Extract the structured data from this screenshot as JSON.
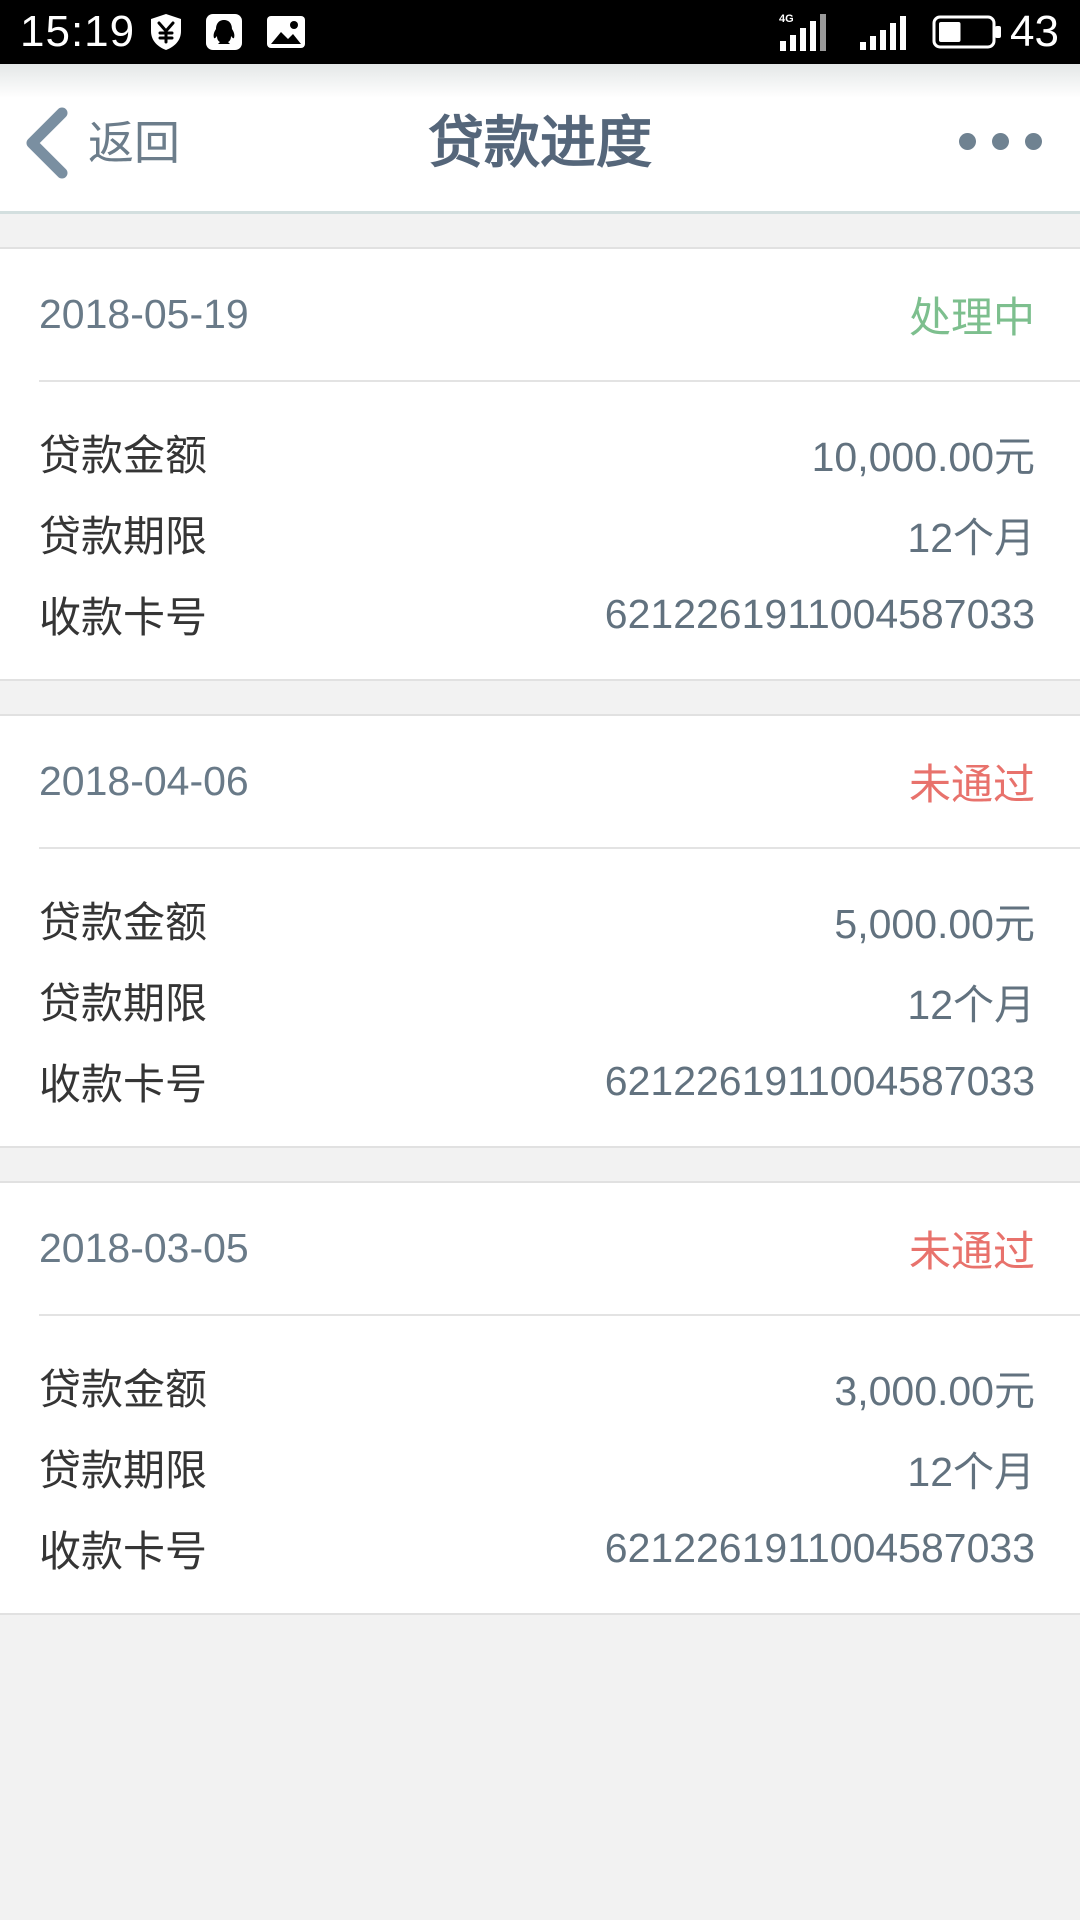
{
  "status_bar": {
    "time": "15:19",
    "network_type": "4G",
    "battery_percent": "43",
    "notification_icons": [
      "shield-yen-icon",
      "qq-icon",
      "image-icon"
    ],
    "system_icons": [
      "signal-4g-icon",
      "signal-icon",
      "battery-icon"
    ]
  },
  "nav": {
    "back_icon": "chevron-left-icon",
    "back_label": "返回",
    "title": "贷款进度",
    "more_icon": "more-dots-icon"
  },
  "loans": [
    {
      "date": "2018-05-19",
      "status": "处理中",
      "status_color": "#7dbf8e",
      "rows": [
        {
          "label": "贷款金额",
          "value": "10,000.00元"
        },
        {
          "label": "贷款期限",
          "value": "12个月"
        },
        {
          "label": "收款卡号",
          "value": "6212261911004587033"
        }
      ]
    },
    {
      "date": "2018-04-06",
      "status": "未通过",
      "status_color": "#e8726c",
      "rows": [
        {
          "label": "贷款金额",
          "value": "5,000.00元"
        },
        {
          "label": "贷款期限",
          "value": "12个月"
        },
        {
          "label": "收款卡号",
          "value": "6212261911004587033"
        }
      ]
    },
    {
      "date": "2018-03-05",
      "status": "未通过",
      "status_color": "#e8726c",
      "rows": [
        {
          "label": "贷款金额",
          "value": "3,000.00元"
        },
        {
          "label": "贷款期限",
          "value": "12个月"
        },
        {
          "label": "收款卡号",
          "value": "6212261911004587033"
        }
      ]
    }
  ],
  "colors": {
    "status_bar_bg": "#000000",
    "page_bg": "#f2f2f2",
    "nav_title": "#55667a",
    "nav_icon": "#6f8291",
    "processing": "#7dbf8e",
    "rejected": "#e8726c",
    "label_text": "#353535",
    "value_text": "#62727f"
  }
}
